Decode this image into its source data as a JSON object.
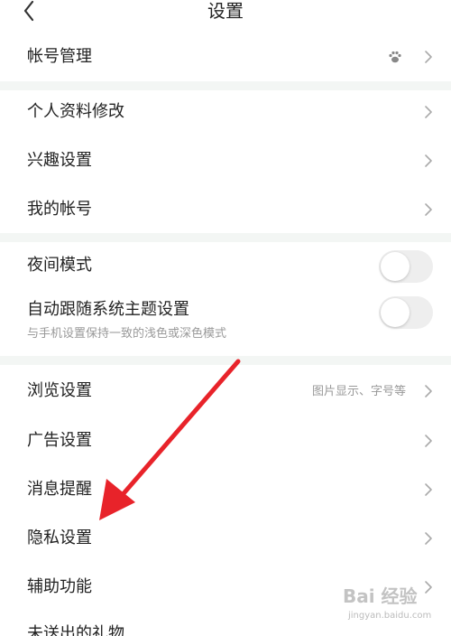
{
  "header": {
    "title": "设置"
  },
  "account": {
    "label": "帐号管理"
  },
  "group1": [
    {
      "label": "个人资料修改"
    },
    {
      "label": "兴趣设置"
    },
    {
      "label": "我的帐号"
    }
  ],
  "night_mode": {
    "label": "夜间模式",
    "enabled": false
  },
  "follow_system": {
    "label": "自动跟随系统主题设置",
    "sublabel": "与手机设置保持一致的浅色或深色模式",
    "enabled": false
  },
  "group3": [
    {
      "label": "浏览设置",
      "value": "图片显示、字号等"
    },
    {
      "label": "广告设置"
    },
    {
      "label": "消息提醒"
    },
    {
      "label": "隐私设置"
    },
    {
      "label": "辅助功能"
    },
    {
      "label": "未送出的礼物"
    }
  ],
  "watermark": {
    "main": "Bai 经验",
    "sub": "jingyan.baidu.com"
  },
  "colors": {
    "annotation_arrow": "#e8232a",
    "divider": "#f3f6f4",
    "toggle_off": "#eeeeee",
    "secondary_text": "#999999"
  },
  "icons": {
    "back": "chevron-left-icon",
    "chevron": "chevron-right-icon",
    "account": "paw-icon"
  }
}
